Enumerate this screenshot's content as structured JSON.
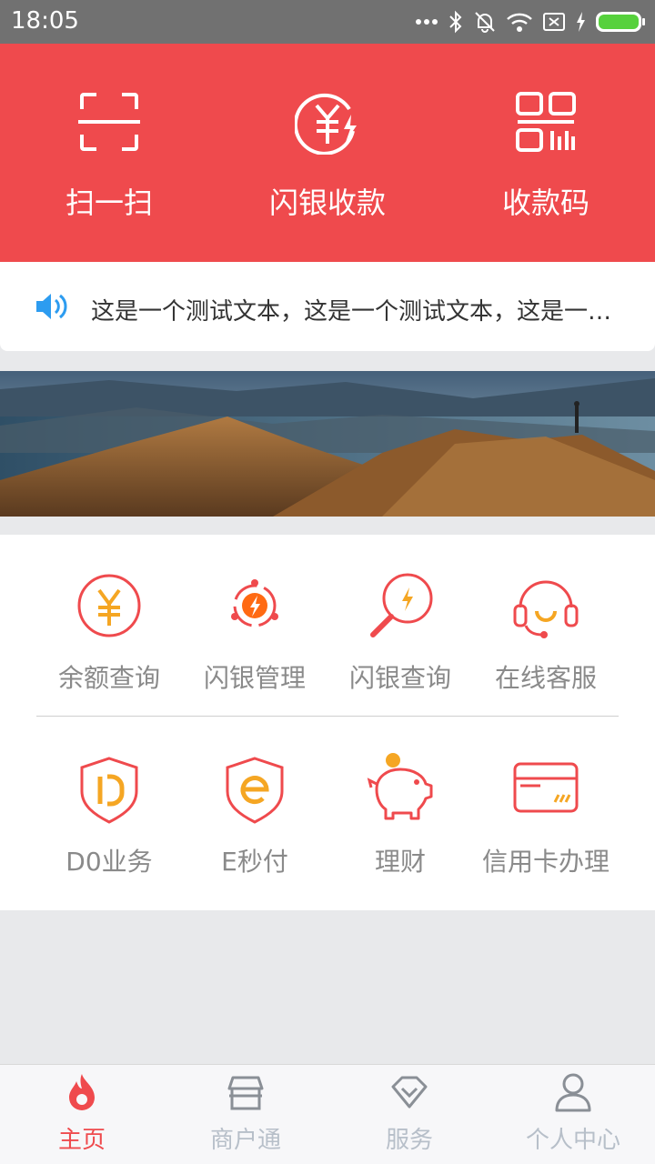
{
  "status_bar": {
    "time": "18:05"
  },
  "header": {
    "actions": [
      {
        "label": "扫一扫",
        "icon": "scan-icon"
      },
      {
        "label": "闪银收款",
        "icon": "yuan-flash-icon"
      },
      {
        "label": "收款码",
        "icon": "qr-code-icon"
      }
    ]
  },
  "notice": {
    "icon": "speaker-icon",
    "text": "这是一个测试文本，这是一个测试文本，这是一个测试文本"
  },
  "services": {
    "row1": [
      {
        "label": "余额查询",
        "icon": "yuan-circle-icon"
      },
      {
        "label": "闪银管理",
        "icon": "flash-gear-icon"
      },
      {
        "label": "闪银查询",
        "icon": "magnifier-flash-icon"
      },
      {
        "label": "在线客服",
        "icon": "headset-icon"
      }
    ],
    "row2": [
      {
        "label": "D0业务",
        "icon": "shield-d-icon"
      },
      {
        "label": "E秒付",
        "icon": "shield-e-icon"
      },
      {
        "label": "理财",
        "icon": "piggy-bank-icon"
      },
      {
        "label": "信用卡办理",
        "icon": "credit-card-icon"
      }
    ]
  },
  "bottom_nav": [
    {
      "label": "主页",
      "icon": "flame-icon",
      "active": true
    },
    {
      "label": "商户通",
      "icon": "store-icon"
    },
    {
      "label": "服务",
      "icon": "diamond-icon"
    },
    {
      "label": "个人中心",
      "icon": "person-icon"
    }
  ],
  "colors": {
    "primary": "#ef4a4d",
    "accent": "#f5a623",
    "muted_text": "#8a8a8a",
    "nav_inactive": "#b7bfc9"
  }
}
